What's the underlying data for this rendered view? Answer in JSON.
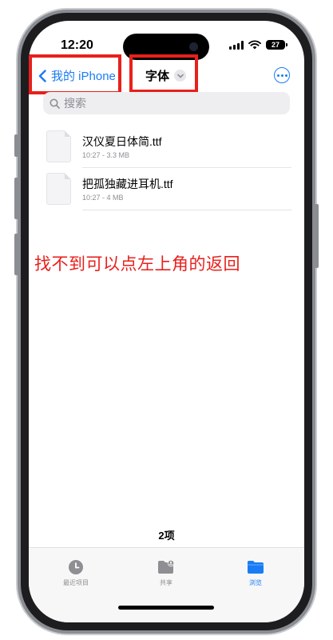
{
  "status_bar": {
    "time": "12:20",
    "battery_level": "27"
  },
  "nav": {
    "back_label": "我的 iPhone",
    "folder_title": "字体"
  },
  "search": {
    "placeholder": "搜索"
  },
  "files": [
    {
      "name": "汉仪夏日体简.ttf",
      "meta": "10:27 - 3.3 MB"
    },
    {
      "name": "把孤独藏进耳机.ttf",
      "meta": "10:27 - 4 MB"
    }
  ],
  "annotation": "找不到可以点左上角的返回",
  "item_count": "2项",
  "tabs": [
    {
      "label": "最近项目",
      "icon": "clock-icon"
    },
    {
      "label": "共享",
      "icon": "shared-folder-icon"
    },
    {
      "label": "浏览",
      "icon": "folder-icon",
      "selected": true
    }
  ],
  "colors": {
    "accent": "#1a7cf5",
    "annotation_red": "#e8201c"
  }
}
